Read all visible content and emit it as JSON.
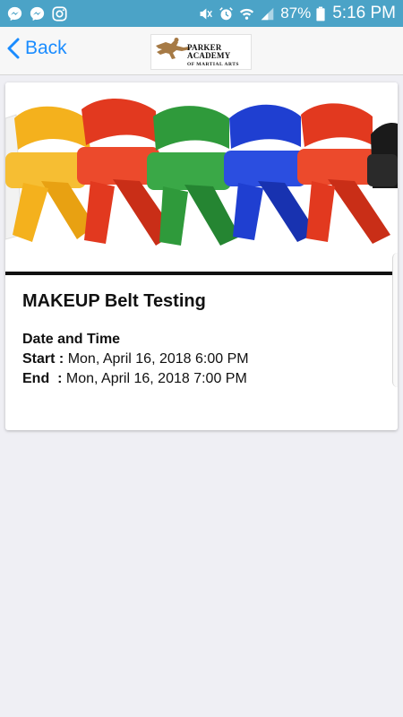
{
  "status_bar": {
    "left_icons": [
      "messenger-icon",
      "messenger-icon",
      "instagram-icon"
    ],
    "right_icons": [
      "mute-icon",
      "alarm-icon",
      "wifi-icon",
      "signal-icon",
      "battery-icon"
    ],
    "battery_percent": "87%",
    "time": "5:16 PM",
    "background": "#4ba3c7"
  },
  "nav": {
    "back_label": "Back",
    "logo_name": "PARKER ACADEMY",
    "logo_sub": "OF MARTIAL ARTS",
    "accent": "#1a8cff"
  },
  "event": {
    "title": "MAKEUP Belt Testing",
    "date_time_heading": "Date and Time",
    "start_label": "Start :",
    "start_value": "Mon, April 16, 2018 6:00 PM",
    "end_label": "End  :",
    "end_value": "Mon, April 16, 2018 7:00 PM",
    "banner_belt_colors": [
      "#f4b11d",
      "#e2391f",
      "#2f9a3b",
      "#1f3fd1",
      "#e2391f",
      "#1a1a1a"
    ]
  }
}
